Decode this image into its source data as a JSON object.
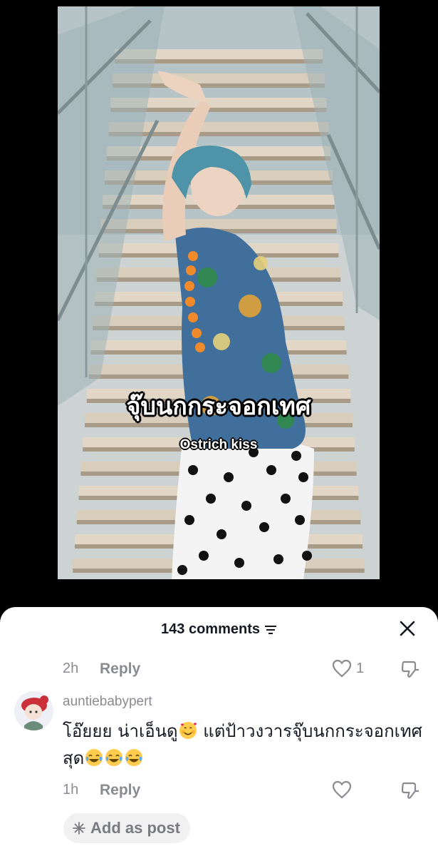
{
  "video": {
    "caption_thai": "จุ๊บนกกระจอกเทศ",
    "caption_english": "Ostrich kiss"
  },
  "comments_panel": {
    "count_label": "143 comments",
    "filter_icon": "filter-lines-icon",
    "close_icon": "close-icon"
  },
  "previous_comment": {
    "time": "2h",
    "reply_label": "Reply",
    "like_count": "1"
  },
  "comment": {
    "username": "auntiebabypert",
    "text_part1": "โอ๊ยยย น่าเอ็นดู",
    "text_part2": " แต่ป้าวงวารจุ๊บนกกระจอกเทศสุด",
    "emojis": [
      "smiling-face-with-hearts",
      "face-with-tears-of-joy",
      "face-with-tears-of-joy",
      "face-with-tears-of-joy"
    ],
    "time": "1h",
    "reply_label": "Reply",
    "add_as_post_label": "Add as post"
  },
  "colors": {
    "text_primary": "#161823",
    "text_secondary": "#8a8b91",
    "sheet_background": "#ffffff",
    "pill_background": "#f1f1f2"
  }
}
